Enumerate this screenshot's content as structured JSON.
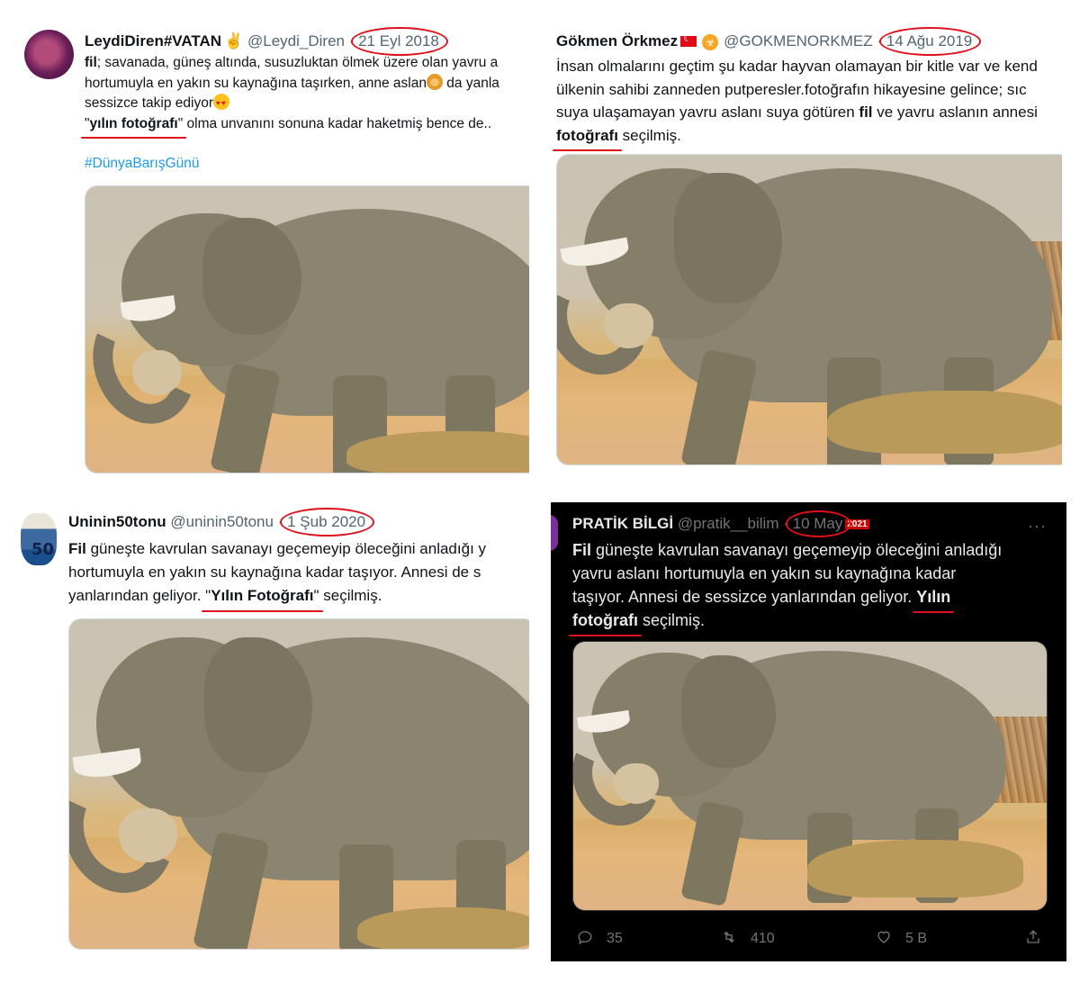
{
  "tweets": [
    {
      "name": "LeydiDiren#VATAN",
      "handle": "@Leydi_Diren",
      "date": "21 Eyl 2018",
      "line1_bold": "fil",
      "line1": "; savanada, güneş altında, susuzluktan ölmek üzere olan yavru a",
      "line2a": "hortumuyla en yakın su kaynağına taşırken, anne aslan",
      "line2b": " da yanla",
      "line3": "sessizce takip ediyor",
      "line4_q1": "\"",
      "line4_bold": "yılın fotoğrafı",
      "line4_q2": "\"",
      "line4_rest": " olma unvanını sonuna kadar haketmiş bence de..",
      "hashtag": "#DünyaBarışGünü"
    },
    {
      "name": "Gökmen Örkmez",
      "handle": "@GOKMENORKMEZ",
      "date": "14 Ağu 2019",
      "line1": "İnsan olmalarını geçtim şu kadar hayvan olamayan bir kitle var ve kend",
      "line2": "ülkenin sahibi zanneden putperesler.fotoğrafın hikayesine gelince; sıc",
      "line3a": "suya ulaşamayan yavru aslanı suya götüren ",
      "line3_bold": "fil",
      "line3b": " ve yavru aslanın annesi",
      "line4_bold": "fotoğrafı",
      "line4_rest": " seçilmiş."
    },
    {
      "name": "Uninin50tonu",
      "handle": "@uninin50tonu",
      "date": "1 Şub 2020",
      "avatar_text": "50",
      "line1_bold": "Fil",
      "line1": " güneşte kavrulan savanayı geçemeyip öleceğini anladığı y",
      "line2": "hortumuyla en yakın su kaynağına kadar taşıyor. Annesi de s",
      "line3a": "yanlarından geliyor. ",
      "line3_q1": "\"",
      "line3_bold": "Yılın Fotoğrafı",
      "line3_q2": "\"",
      "line3_rest": " seçilmiş."
    },
    {
      "name": "PRATİK BİLGİ",
      "handle": "@pratik__bilim",
      "date": "10 May",
      "year": "2021",
      "line1_bold": "Fil",
      "line1": " güneşte kavrulan savanayı geçemeyip öleceğini anladığı",
      "line2": "yavru aslanı hortumuyla en yakın su kaynağına kadar",
      "line3a": "taşıyor. Annesi de sessizce yanlarından geliyor. ",
      "line3_bold": "Yılın",
      "line4_bold": "fotoğrafı",
      "line4_rest": " seçilmiş.",
      "more": "···",
      "replies": "35",
      "retweets": "410",
      "likes": "5 B"
    }
  ],
  "icons": [
    "reply-icon",
    "retweet-icon",
    "like-icon",
    "share-icon",
    "more-icon",
    "flag-icon",
    "biohazard-icon",
    "lion-icon",
    "heart-eyes-icon",
    "victory-icon"
  ],
  "colors": {
    "highlight": "#e0101a",
    "link": "#1d9bf0",
    "dark_bg": "#000000"
  }
}
